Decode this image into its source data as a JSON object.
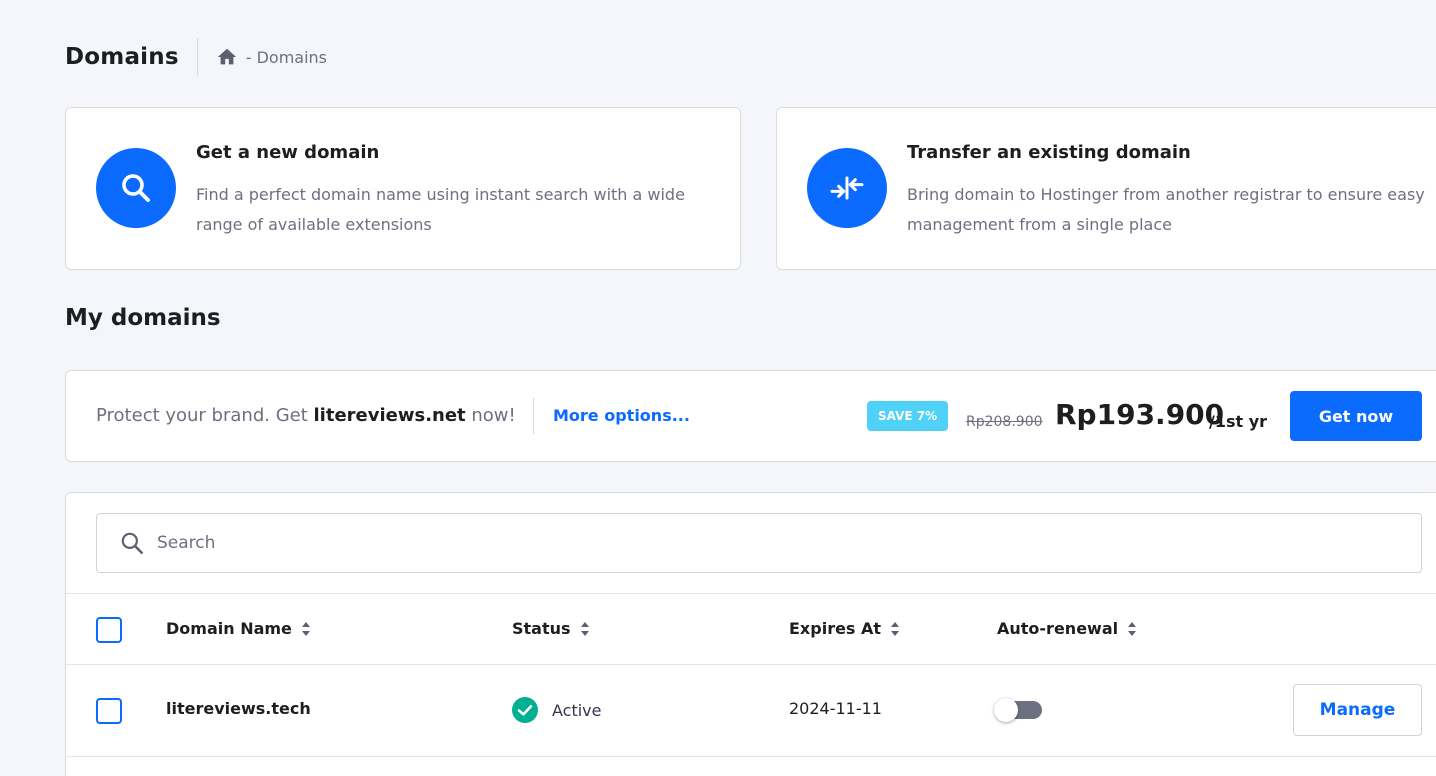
{
  "header": {
    "title": "Domains",
    "breadcrumb": "- Domains"
  },
  "cards": {
    "new_domain": {
      "title": "Get a new domain",
      "description": "Find a perfect domain name using instant search with a wide range of available extensions",
      "icon": "search-icon"
    },
    "transfer": {
      "title": "Transfer an existing domain",
      "description": "Bring domain to Hostinger from another registrar to ensure easy management from a single place",
      "icon": "transfer-arrows-icon"
    }
  },
  "my_domains": {
    "title": "My domains"
  },
  "promo": {
    "text_before": "Protect your brand. Get ",
    "domain": "litereviews.net",
    "text_after": " now!",
    "more_options": "More options...",
    "badge": "SAVE 7%",
    "old_price": "Rp208.900",
    "new_price": "Rp193.900",
    "period": "/1st yr",
    "button": "Get now"
  },
  "search": {
    "placeholder": "Search"
  },
  "table": {
    "columns": [
      "Domain Name",
      "Status",
      "Expires At",
      "Auto-renewal"
    ],
    "rows": [
      {
        "domain": "litereviews.tech",
        "status": "Active",
        "expires": "2024-11-11",
        "auto_renewal": false,
        "action": "Manage"
      }
    ]
  },
  "colors": {
    "primary": "#0b6bff",
    "success": "#00b090",
    "badge": "#4fd1f8",
    "background": "#f4f6fb"
  }
}
